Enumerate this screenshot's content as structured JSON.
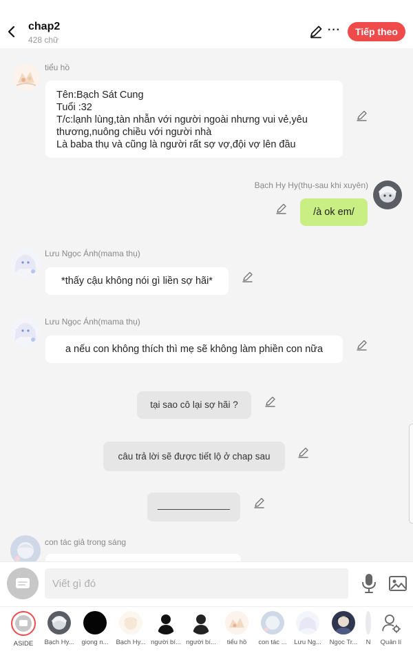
{
  "header": {
    "title": "chap2",
    "word_count": "428 chữ",
    "next_label": "Tiếp theo",
    "more_label": "···",
    "accent_color": "#f04b4b"
  },
  "messages": [
    {
      "sender": "tiểu hồ",
      "lines": [
        "Tên:Bạch Sát Cung",
        "Tuổi :32",
        "T/c:lạnh lùng,tàn nhẫn với người ngoài nhưng vui vẻ,yêu",
        "thương,nuông chiều với người nhà",
        "Là baba thụ và cũng là người rất sợ vợ,đội vợ lên đầu"
      ]
    },
    {
      "sender": "Bạch Hy Hy(thụ-sau khi xuyên)",
      "text": "/à ok em/"
    },
    {
      "sender": "Lưu Ngọc Ánh(mama thụ)",
      "text": "*thấy cậu không nói gì liền sợ hãi*"
    },
    {
      "sender": "Lưu Ngọc Ánh(mama thụ)",
      "text": "a nếu con không thích thì mẹ sẽ không làm phiền con nữa"
    },
    {
      "text": "tại sao cô lại sợ hãi ?"
    },
    {
      "text": "câu trả lời sẽ được tiết lộ ở chap sau"
    },
    {
      "text": "______________"
    },
    {
      "sender": "con tác giả trong sáng"
    }
  ],
  "composer": {
    "placeholder": "Viết gì đó"
  },
  "characters": [
    {
      "label": "ASIDE"
    },
    {
      "label": "Bạch Hy..."
    },
    {
      "label": "giọng n..."
    },
    {
      "label": "Bạch Hy..."
    },
    {
      "label": "người bí..."
    },
    {
      "label": "người bí..."
    },
    {
      "label": "tiểu hồ"
    },
    {
      "label": "con tác ..."
    },
    {
      "label": "Lưu Ng..."
    },
    {
      "label": "Ngọc Tr..."
    },
    {
      "label": "N"
    },
    {
      "label": "Quản lí"
    }
  ]
}
